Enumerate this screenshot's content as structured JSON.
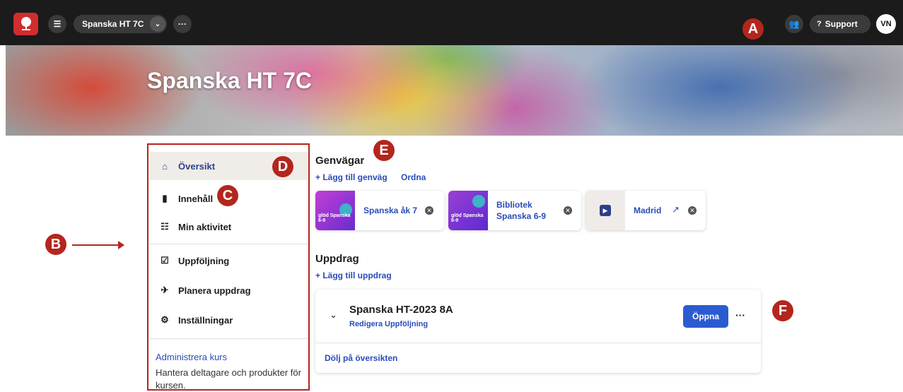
{
  "topbar": {
    "course_selector": "Spanska HT 7C",
    "support_label": "Support",
    "avatar_initials": "VN"
  },
  "banner": {
    "title": "Spanska HT 7C"
  },
  "sidebar": {
    "items": [
      {
        "label": "Översikt",
        "icon": "home-icon"
      },
      {
        "label": "Innehåll",
        "icon": "book-icon"
      },
      {
        "label": "Min aktivitet",
        "icon": "activity-icon"
      },
      {
        "label": "Uppföljning",
        "icon": "checkbox-icon"
      },
      {
        "label": "Planera uppdrag",
        "icon": "plane-icon"
      },
      {
        "label": "Inställningar",
        "icon": "gear-icon"
      }
    ],
    "admin_link": "Administrera kurs",
    "admin_text": "Hantera deltagare och produkter för kursen."
  },
  "shortcuts": {
    "heading": "Genvägar",
    "add_label": "Lägg till genväg",
    "order_label": "Ordna",
    "cards": [
      {
        "label": "Spanska åk 7",
        "thumb": "glöd Spanska 6-9"
      },
      {
        "label": "Bibliotek Spanska 6-9",
        "thumb": "glöd Spanska 6-9"
      },
      {
        "label": "Madrid"
      }
    ]
  },
  "assignments": {
    "heading": "Uppdrag",
    "add_label": "Lägg till uppdrag",
    "item": {
      "title": "Spanska HT-2023 8A",
      "edit_label": "Redigera",
      "followup_label": "Uppföljning",
      "open_label": "Öppna",
      "hide_label": "Dölj på översikten"
    }
  },
  "markers": [
    "A",
    "B",
    "C",
    "D",
    "E",
    "F"
  ],
  "colors": {
    "accent": "#2b5bd1",
    "marker": "#b3261e",
    "topbar": "#1b1b1b"
  }
}
